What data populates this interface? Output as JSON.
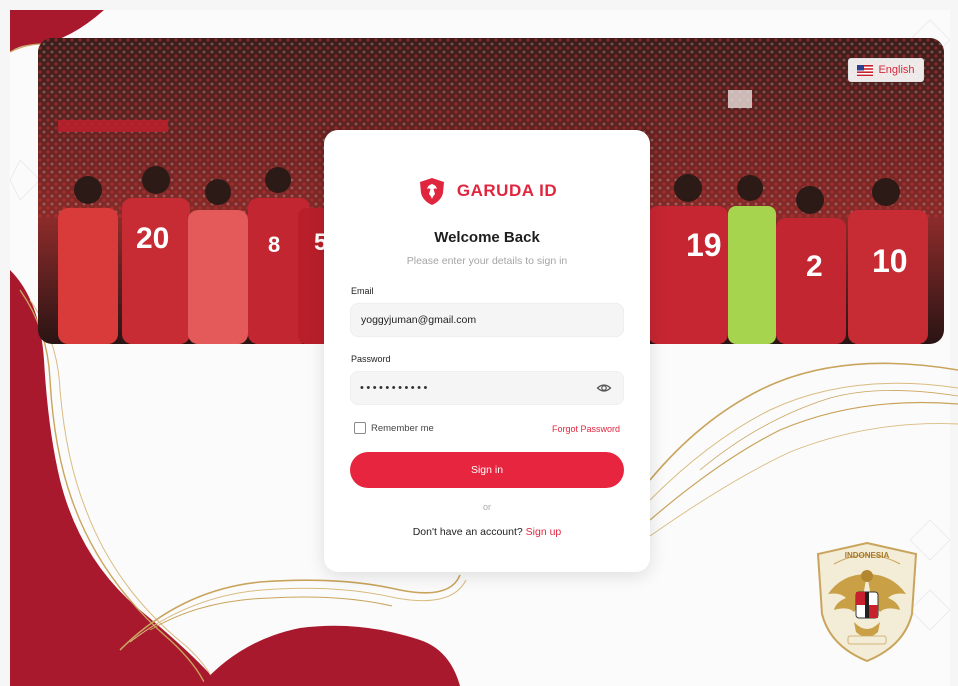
{
  "language": {
    "label": "English",
    "icon": "us-flag-icon"
  },
  "brand": {
    "name": "GARUDA ID",
    "icon": "garuda-shield-icon"
  },
  "login": {
    "title": "Welcome Back",
    "subtitle": "Please enter your details to sign in",
    "email_label": "Email",
    "email_value": "yoggyjuman@gmail.com",
    "password_label": "Password",
    "password_masked": "•••••••••••",
    "show_password_icon": "eye-icon",
    "remember_label": "Remember me",
    "forgot_label": "Forgot Password",
    "signin_label": "Sign in",
    "or_label": "or",
    "no_account_text": "Don't have an account? ",
    "signup_label": "Sign up"
  },
  "hero": {
    "description": "stadium-crowd-photo",
    "jersey_numbers": [
      "20",
      "8",
      "5",
      "19",
      "2",
      "10"
    ]
  },
  "emblem": {
    "text": "INDONESIA",
    "icon": "pssi-garuda-emblem"
  },
  "colors": {
    "accent": "#e8253f",
    "brand_red": "#e0263f",
    "maroon": "#a8192e",
    "gold": "#c9a45c"
  }
}
